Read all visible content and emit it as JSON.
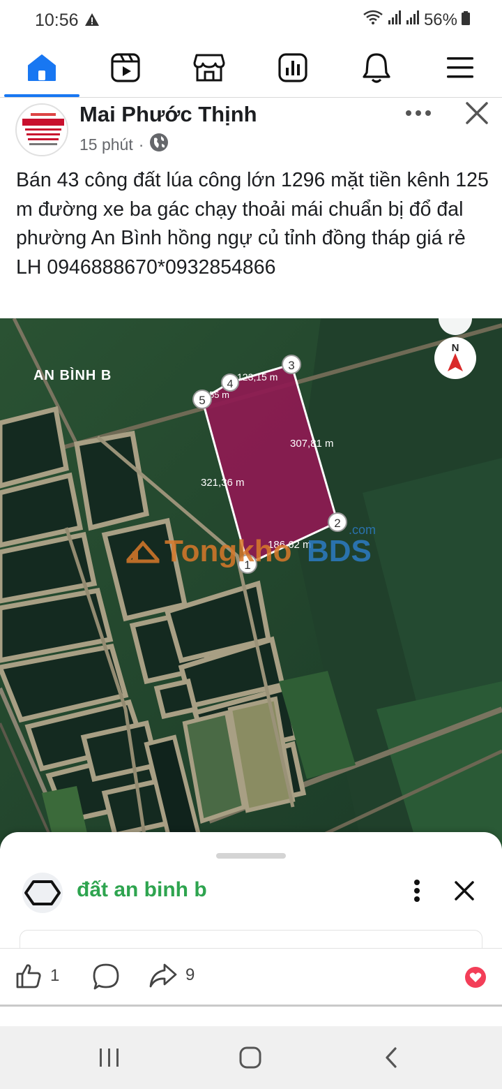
{
  "status_bar": {
    "time": "10:56",
    "battery": "56%",
    "icons": [
      "warning-icon",
      "wifi-icon",
      "signal-icon",
      "signal-icon",
      "battery-icon"
    ]
  },
  "nav": {
    "accent": "#1877f2",
    "items": [
      "home-icon",
      "video-icon",
      "marketplace-icon",
      "dashboard-icon",
      "notifications-icon",
      "menu-icon"
    ],
    "active": "home"
  },
  "post": {
    "author": "Mai Phước Thịnh",
    "time": "15 phút",
    "separator": "·",
    "visibility_icon": "globe-icon",
    "text": "Bán 43 công đất lúa công lớn 1296 mặt tiền kênh 125 m đường xe ba gác chạy thoải mái chuẩn bị đổ đal  phường An Bình  hồng ngự củ tỉnh đồng tháp giá rẻ LH 0946888670*0932854866"
  },
  "map": {
    "area_label": "AN BÌNH B",
    "parcel_color": "#8e1a52",
    "compass": "N",
    "watermark_a": "Tongkho",
    "watermark_b": "BDS",
    "watermark_c": ".com",
    "measures": {
      "edge_1_2": "186,62 m",
      "edge_2_3": "307,81 m",
      "edge_3_4": "123,15 m",
      "edge_4_5": "55 m",
      "edge_5_1": "321,36 m"
    },
    "markers": [
      "1",
      "2",
      "3",
      "4",
      "5"
    ]
  },
  "sheet": {
    "title": "đất an binh b",
    "title_color": "#2ea44f"
  },
  "reactions": {
    "likes": "1",
    "shares": "9"
  }
}
